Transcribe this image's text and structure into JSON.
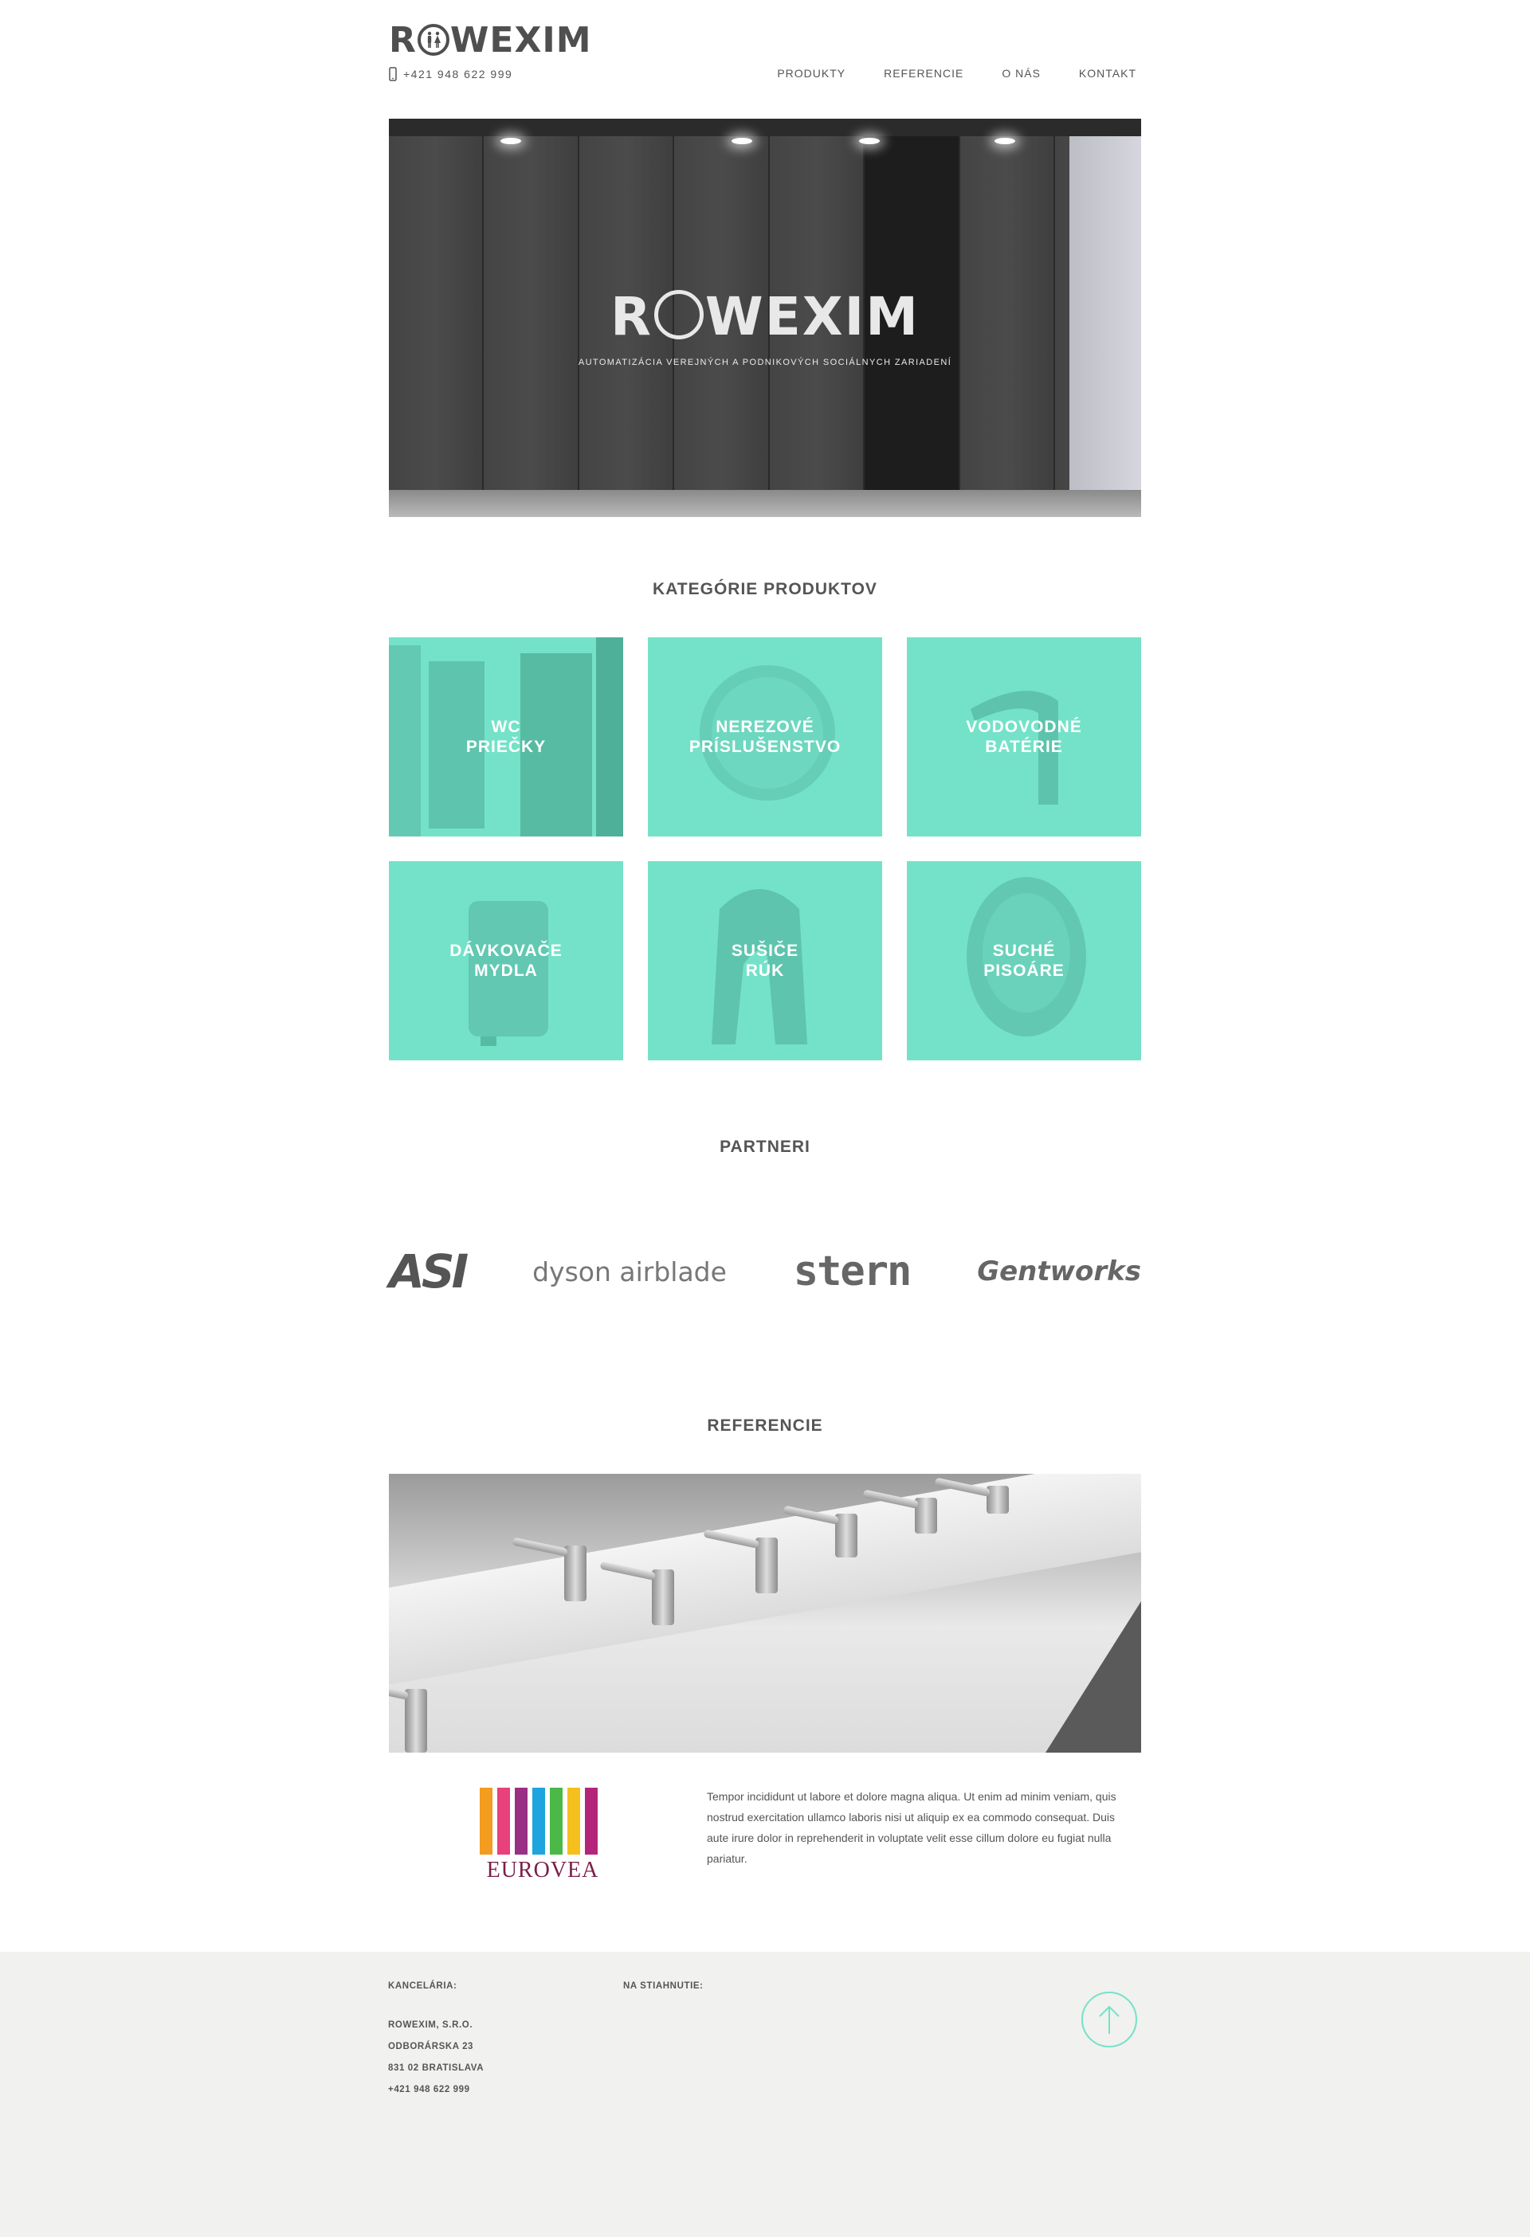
{
  "brand": {
    "name": "ROWEXIM",
    "name_left": "R",
    "name_right": "WEXIM",
    "phone": "+421 948 622 999",
    "accent": "#74e2c8"
  },
  "nav": {
    "items": [
      "PRODUKTY",
      "REFERENCIE",
      "O NÁS",
      "KONTAKT"
    ],
    "active": "PRODUKTY"
  },
  "hero": {
    "title_left": "R",
    "title_right": "WEXIM",
    "subtitle": "AUTOMATIZÁCIA VEREJNÝCH A PODNIKOVÝCH SOCIÁLNYCH ZARIADENÍ"
  },
  "categories": {
    "title": "KATEGÓRIE PRODUKTOV",
    "items": [
      {
        "label": "WC\nPRIEČKY",
        "icon": "partition-icon"
      },
      {
        "label": "NEREZOVÉ\nPRÍSLUŠENSTVO",
        "icon": "dispenser-icon"
      },
      {
        "label": "VODOVODNÉ\nBATÉRIE",
        "icon": "faucet-icon"
      },
      {
        "label": "DÁVKOVAČE\nMYDLA",
        "icon": "soap-dispenser-icon"
      },
      {
        "label": "SUŠIČE\nRÚK",
        "icon": "hand-dryer-icon"
      },
      {
        "label": "SUCHÉ\nPISOÁRE",
        "icon": "urinal-icon"
      }
    ]
  },
  "partners": {
    "title": "PARTNERI",
    "logos": [
      "ASI",
      "dyson airblade",
      "stern",
      "Gentworks"
    ]
  },
  "references": {
    "title": "REFERENCIE",
    "client": "EUROVEA",
    "text": "Tempor incididunt ut labore et dolore magna aliqua. Ut enim ad minim veniam, quis nostrud exercitation ullamco laboris nisi ut aliquip ex ea commodo consequat. Duis aute irure dolor in reprehenderit in voluptate velit esse cillum dolore eu fugiat nulla pariatur."
  },
  "footer": {
    "office_head": "KANCELÁRIA:",
    "office_lines": [
      "ROWEXIM, S.R.O.",
      "ODBORÁRSKA 23",
      "831 02 BRATISLAVA",
      "+421 948 622 999"
    ],
    "download_head": "NA STIAHNUTIE:",
    "to_top_icon": "arrow-up-icon"
  }
}
